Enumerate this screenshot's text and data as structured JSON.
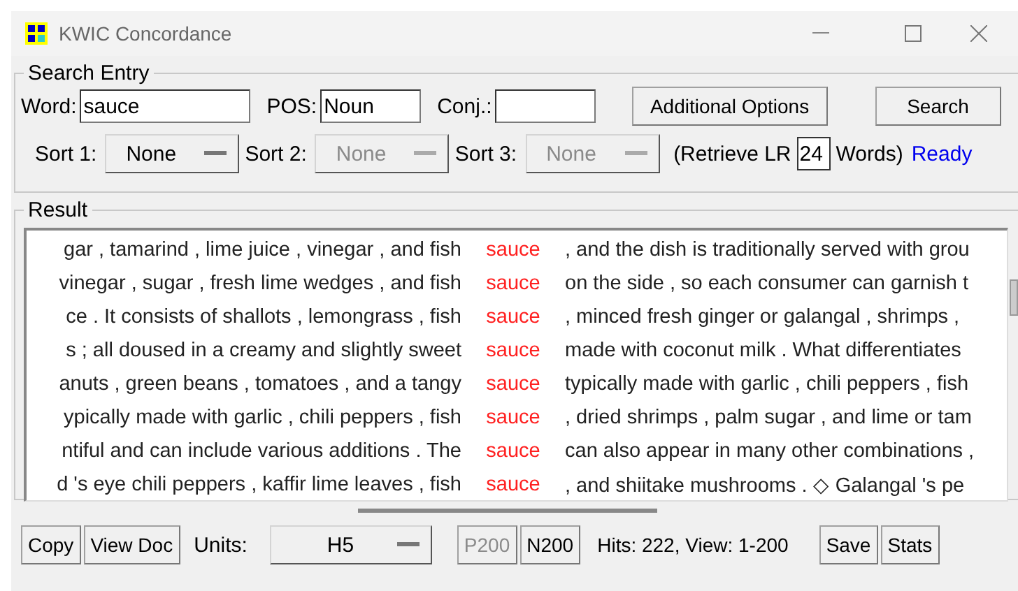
{
  "window": {
    "title": "KWIC Concordance"
  },
  "search_entry": {
    "title": "Search Entry",
    "word_label": "Word:",
    "word": "sauce",
    "pos_label": "POS:",
    "pos": "Noun",
    "conj_label": "Conj.:",
    "additional_button": "Additional Options",
    "search_button": "Search",
    "sorts": [
      {
        "label": "Sort 1:",
        "value": "None",
        "disabled": false
      },
      {
        "label": "Sort 2:",
        "value": "None",
        "disabled": true
      },
      {
        "label": "Sort 3:",
        "value": "None",
        "disabled": true
      }
    ],
    "retrieve_label": "(Retrieve LR",
    "retrieve_value": "24",
    "words_label": "Words)",
    "status": "Ready"
  },
  "result": {
    "title": "Result",
    "rows": [
      {
        "left": "gar , tamarind , lime juice , vinegar , and fish",
        "keyword": "sauce",
        "right": ", and the dish is traditionally served with grou"
      },
      {
        "left": "vinegar , sugar , fresh lime wedges , and fish",
        "keyword": "sauce",
        "right": "on the side , so each consumer can garnish t"
      },
      {
        "left": "ce . It consists of shallots , lemongrass , fish",
        "keyword": "sauce",
        "right": ", minced fresh ginger or galangal , shrimps ,"
      },
      {
        "left": "s ; all doused in a creamy and slightly sweet",
        "keyword": "sauce",
        "right": "made with coconut milk . What differentiates"
      },
      {
        "left": "anuts , green beans , tomatoes , and a tangy",
        "keyword": "sauce",
        "right": "typically made with garlic , chili peppers , fish"
      },
      {
        "left": "ypically made with garlic , chili peppers , fish",
        "keyword": "sauce",
        "right": ", dried shrimps , palm sugar , and lime or tam"
      },
      {
        "left": "ntiful and can include various additions . The",
        "keyword": "sauce",
        "right": "can also appear in many other combinations ,"
      },
      {
        "left": "d 's eye chili peppers , kaffir lime leaves , fish",
        "keyword": "sauce",
        "right": ", and shiitake mushrooms . ◇ Galangal 's pe"
      }
    ]
  },
  "bottom_bar": {
    "buttons": [
      {
        "label": "Copy",
        "disabled": false
      },
      {
        "label": "View Doc",
        "disabled": false
      }
    ],
    "units_label": "Units:",
    "units": "H5",
    "page_buttons": [
      {
        "label": "P200",
        "disabled": true
      },
      {
        "label": "N200",
        "disabled": false
      }
    ],
    "hits": "Hits: 222, View: 1-200",
    "right_buttons": [
      {
        "label": "Save",
        "disabled": false
      },
      {
        "label": "Stats",
        "disabled": false
      }
    ]
  }
}
